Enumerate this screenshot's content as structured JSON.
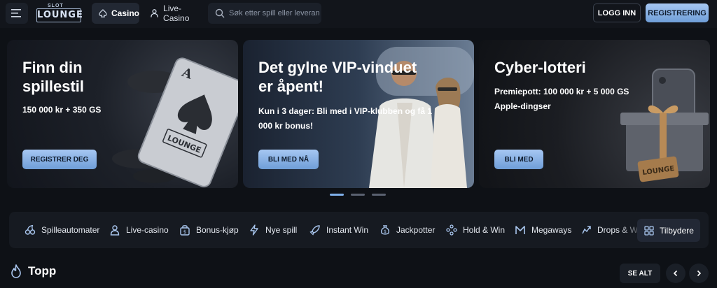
{
  "header": {
    "logo": {
      "top": "SLOT",
      "main": "LOUNGE"
    },
    "tabs": [
      {
        "label": "Casino",
        "icon": "spade-icon",
        "active": true
      },
      {
        "label": "Live-Casino",
        "icon": "dealer-icon",
        "active": false
      }
    ],
    "search": {
      "placeholder": "Søk etter spill eller leverandør"
    },
    "login_label": "LOGG INN",
    "register_label": "REGISTRERING",
    "accent_color": "#8fb8ea"
  },
  "promos": [
    {
      "title_line1": "Finn din",
      "title_line2": "spillestil",
      "subtitle_line1": "150 000 kr + 350 GS",
      "subtitle_line2": "",
      "cta": "REGISTRER DEG",
      "art": "playing-card-with-chips"
    },
    {
      "title_line1": "Det gylne VIP-vinduet",
      "title_line2": "er åpent!",
      "subtitle_line1": "Kun i 3 dager: Bli med i VIP-klubben og få 1",
      "subtitle_line2": "000 kr bonus!",
      "cta": "BLI MED NÅ",
      "art": "couple-at-private-jet"
    },
    {
      "title_line1": "Cyber-lotteri",
      "title_line2": "",
      "subtitle_line1": "Premiepott: 100 000 kr + 5 000 GS",
      "subtitle_line2": "Apple-dingser",
      "cta": "BLI MED",
      "art": "gift-box-and-phone"
    }
  ],
  "carousel": {
    "slides": 3,
    "active_index": 0
  },
  "categories": [
    {
      "label": "Spilleautomater",
      "icon": "cherries-icon"
    },
    {
      "label": "Live-casino",
      "icon": "dealer-icon"
    },
    {
      "label": "Bonus-kjøp",
      "icon": "bonus-buy-icon"
    },
    {
      "label": "Nye spill",
      "icon": "lightning-icon"
    },
    {
      "label": "Instant Win",
      "icon": "rocket-icon"
    },
    {
      "label": "Jackpotter",
      "icon": "money-bag-icon"
    },
    {
      "label": "Hold & Win",
      "icon": "hold-win-icon"
    },
    {
      "label": "Megaways",
      "icon": "megaways-icon"
    },
    {
      "label": "Drops & Wins",
      "icon": "drops-icon"
    },
    {
      "label": "Tilbydere",
      "icon": "grid-icon"
    }
  ],
  "top_section": {
    "title": "Topp",
    "icon": "flame-icon",
    "see_all_label": "SE ALT"
  }
}
